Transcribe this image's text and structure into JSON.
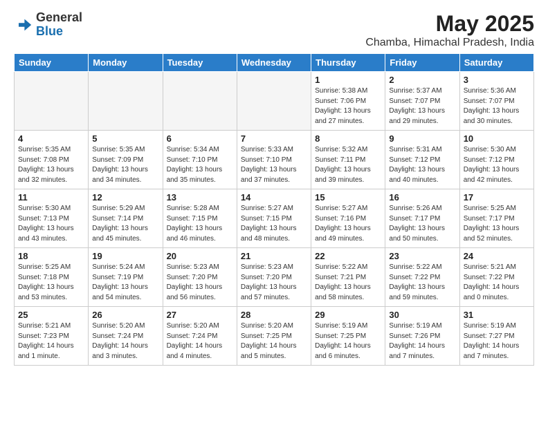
{
  "header": {
    "logo_general": "General",
    "logo_blue": "Blue",
    "month_title": "May 2025",
    "location": "Chamba, Himachal Pradesh, India"
  },
  "weekdays": [
    "Sunday",
    "Monday",
    "Tuesday",
    "Wednesday",
    "Thursday",
    "Friday",
    "Saturday"
  ],
  "weeks": [
    [
      {
        "day": "",
        "info": ""
      },
      {
        "day": "",
        "info": ""
      },
      {
        "day": "",
        "info": ""
      },
      {
        "day": "",
        "info": ""
      },
      {
        "day": "1",
        "info": "Sunrise: 5:38 AM\nSunset: 7:06 PM\nDaylight: 13 hours\nand 27 minutes."
      },
      {
        "day": "2",
        "info": "Sunrise: 5:37 AM\nSunset: 7:07 PM\nDaylight: 13 hours\nand 29 minutes."
      },
      {
        "day": "3",
        "info": "Sunrise: 5:36 AM\nSunset: 7:07 PM\nDaylight: 13 hours\nand 30 minutes."
      }
    ],
    [
      {
        "day": "4",
        "info": "Sunrise: 5:35 AM\nSunset: 7:08 PM\nDaylight: 13 hours\nand 32 minutes."
      },
      {
        "day": "5",
        "info": "Sunrise: 5:35 AM\nSunset: 7:09 PM\nDaylight: 13 hours\nand 34 minutes."
      },
      {
        "day": "6",
        "info": "Sunrise: 5:34 AM\nSunset: 7:10 PM\nDaylight: 13 hours\nand 35 minutes."
      },
      {
        "day": "7",
        "info": "Sunrise: 5:33 AM\nSunset: 7:10 PM\nDaylight: 13 hours\nand 37 minutes."
      },
      {
        "day": "8",
        "info": "Sunrise: 5:32 AM\nSunset: 7:11 PM\nDaylight: 13 hours\nand 39 minutes."
      },
      {
        "day": "9",
        "info": "Sunrise: 5:31 AM\nSunset: 7:12 PM\nDaylight: 13 hours\nand 40 minutes."
      },
      {
        "day": "10",
        "info": "Sunrise: 5:30 AM\nSunset: 7:12 PM\nDaylight: 13 hours\nand 42 minutes."
      }
    ],
    [
      {
        "day": "11",
        "info": "Sunrise: 5:30 AM\nSunset: 7:13 PM\nDaylight: 13 hours\nand 43 minutes."
      },
      {
        "day": "12",
        "info": "Sunrise: 5:29 AM\nSunset: 7:14 PM\nDaylight: 13 hours\nand 45 minutes."
      },
      {
        "day": "13",
        "info": "Sunrise: 5:28 AM\nSunset: 7:15 PM\nDaylight: 13 hours\nand 46 minutes."
      },
      {
        "day": "14",
        "info": "Sunrise: 5:27 AM\nSunset: 7:15 PM\nDaylight: 13 hours\nand 48 minutes."
      },
      {
        "day": "15",
        "info": "Sunrise: 5:27 AM\nSunset: 7:16 PM\nDaylight: 13 hours\nand 49 minutes."
      },
      {
        "day": "16",
        "info": "Sunrise: 5:26 AM\nSunset: 7:17 PM\nDaylight: 13 hours\nand 50 minutes."
      },
      {
        "day": "17",
        "info": "Sunrise: 5:25 AM\nSunset: 7:17 PM\nDaylight: 13 hours\nand 52 minutes."
      }
    ],
    [
      {
        "day": "18",
        "info": "Sunrise: 5:25 AM\nSunset: 7:18 PM\nDaylight: 13 hours\nand 53 minutes."
      },
      {
        "day": "19",
        "info": "Sunrise: 5:24 AM\nSunset: 7:19 PM\nDaylight: 13 hours\nand 54 minutes."
      },
      {
        "day": "20",
        "info": "Sunrise: 5:23 AM\nSunset: 7:20 PM\nDaylight: 13 hours\nand 56 minutes."
      },
      {
        "day": "21",
        "info": "Sunrise: 5:23 AM\nSunset: 7:20 PM\nDaylight: 13 hours\nand 57 minutes."
      },
      {
        "day": "22",
        "info": "Sunrise: 5:22 AM\nSunset: 7:21 PM\nDaylight: 13 hours\nand 58 minutes."
      },
      {
        "day": "23",
        "info": "Sunrise: 5:22 AM\nSunset: 7:22 PM\nDaylight: 13 hours\nand 59 minutes."
      },
      {
        "day": "24",
        "info": "Sunrise: 5:21 AM\nSunset: 7:22 PM\nDaylight: 14 hours\nand 0 minutes."
      }
    ],
    [
      {
        "day": "25",
        "info": "Sunrise: 5:21 AM\nSunset: 7:23 PM\nDaylight: 14 hours\nand 1 minute."
      },
      {
        "day": "26",
        "info": "Sunrise: 5:20 AM\nSunset: 7:24 PM\nDaylight: 14 hours\nand 3 minutes."
      },
      {
        "day": "27",
        "info": "Sunrise: 5:20 AM\nSunset: 7:24 PM\nDaylight: 14 hours\nand 4 minutes."
      },
      {
        "day": "28",
        "info": "Sunrise: 5:20 AM\nSunset: 7:25 PM\nDaylight: 14 hours\nand 5 minutes."
      },
      {
        "day": "29",
        "info": "Sunrise: 5:19 AM\nSunset: 7:25 PM\nDaylight: 14 hours\nand 6 minutes."
      },
      {
        "day": "30",
        "info": "Sunrise: 5:19 AM\nSunset: 7:26 PM\nDaylight: 14 hours\nand 7 minutes."
      },
      {
        "day": "31",
        "info": "Sunrise: 5:19 AM\nSunset: 7:27 PM\nDaylight: 14 hours\nand 7 minutes."
      }
    ]
  ]
}
